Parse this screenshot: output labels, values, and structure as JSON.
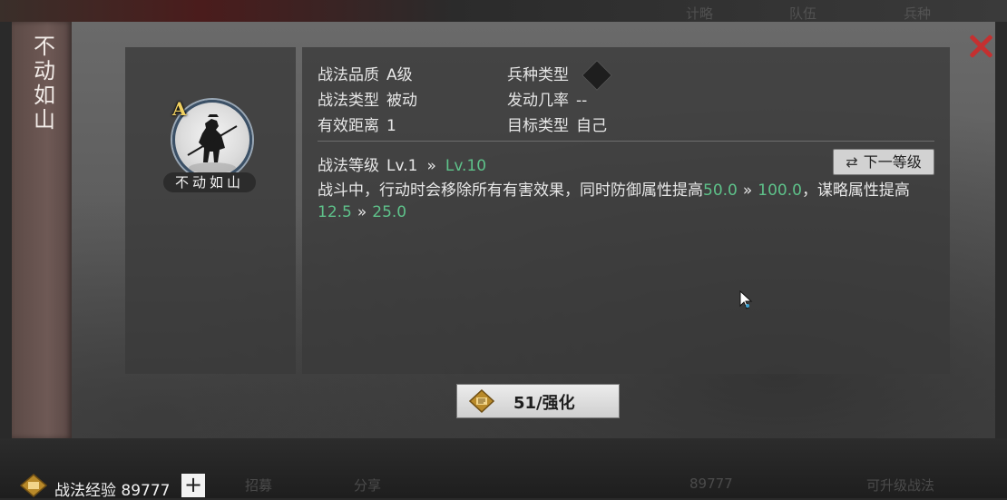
{
  "background": {
    "ghost_labels": [
      "计略",
      "队伍",
      "兵种"
    ]
  },
  "panel": {
    "side_title": "不动如山",
    "skill": {
      "grade_letter": "A",
      "name": "不动如山"
    },
    "info": {
      "quality_label": "战法品质",
      "quality_value": "A级",
      "type_label": "战法类型",
      "type_value": "被动",
      "range_label": "有效距离",
      "range_value": "1",
      "unit_label": "兵种类型",
      "rate_label": "发动几率",
      "rate_value": "--",
      "target_label": "目标类型",
      "target_value": "自己"
    },
    "level": {
      "label": "战法等级",
      "current": "Lv.1",
      "arrow": "»",
      "max": "Lv.10",
      "next_button": "下一等级"
    },
    "description": {
      "part1": "战斗中，行动时会移除所有有害效果，同时防御属性提高",
      "def_from": "50.0",
      "def_to": "100.0",
      "part2": "，谋略属性提高",
      "int_from": "12.5",
      "int_to": "25.0",
      "arrow": "»"
    },
    "upgrade_button": "51/强化"
  },
  "footer": {
    "exp_label": "战法经验",
    "exp_value": "89777",
    "plus": "+",
    "ghost_items": [
      "招募",
      "分享",
      "89777",
      "可升级战法"
    ]
  },
  "colors": {
    "accent_green": "#5ec28a",
    "close_red": "#c43030",
    "grade_gold": "#f0d060"
  }
}
